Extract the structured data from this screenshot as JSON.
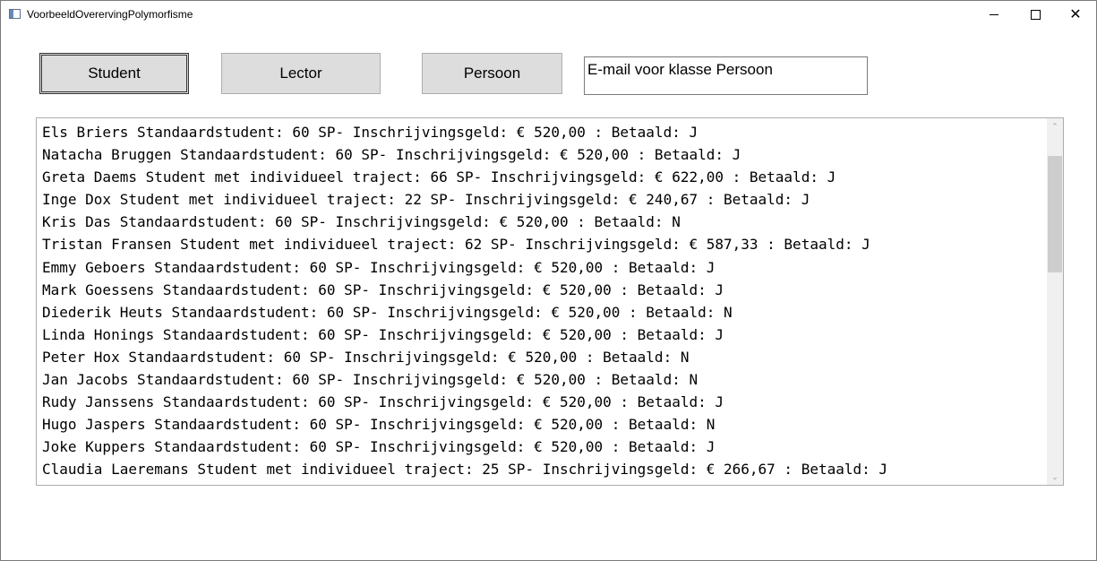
{
  "window": {
    "title": "VoorbeeldOverervingPolymorfisme",
    "minimize_icon": "minimize-icon",
    "maximize_icon": "maximize-icon",
    "close_glyph": "✕"
  },
  "buttons": {
    "student_label": "Student",
    "lector_label": "Lector",
    "persoon_label": "Persoon"
  },
  "email_field": {
    "value": "E-mail voor klasse Persoon"
  },
  "listbox": {
    "items": [
      "Els Briers Standaardstudent: 60 SP- Inschrijvingsgeld: € 520,00 : Betaald: J",
      "Natacha Bruggen Standaardstudent: 60 SP- Inschrijvingsgeld: € 520,00 : Betaald: J",
      "Greta Daems Student met individueel traject: 66 SP- Inschrijvingsgeld: € 622,00 : Betaald: J",
      "Inge Dox Student met individueel traject: 22 SP- Inschrijvingsgeld: € 240,67 : Betaald: J",
      "Kris Das Standaardstudent: 60 SP- Inschrijvingsgeld: € 520,00 : Betaald: N",
      "Tristan Fransen Student met individueel traject: 62 SP- Inschrijvingsgeld: € 587,33 : Betaald: J",
      "Emmy Geboers Standaardstudent: 60 SP- Inschrijvingsgeld: € 520,00 : Betaald: J",
      "Mark Goessens Standaardstudent: 60 SP- Inschrijvingsgeld: € 520,00 : Betaald: J",
      "Diederik Heuts Standaardstudent: 60 SP- Inschrijvingsgeld: € 520,00 : Betaald: N",
      "Linda Honings Standaardstudent: 60 SP- Inschrijvingsgeld: € 520,00 : Betaald: J",
      "Peter Hox Standaardstudent: 60 SP- Inschrijvingsgeld: € 520,00 : Betaald: N",
      "Jan Jacobs Standaardstudent: 60 SP- Inschrijvingsgeld: € 520,00 : Betaald: N",
      "Rudy Janssens Standaardstudent: 60 SP- Inschrijvingsgeld: € 520,00 : Betaald: J",
      "Hugo Jaspers Standaardstudent: 60 SP- Inschrijvingsgeld: € 520,00 : Betaald: N",
      "Joke Kuppers Standaardstudent: 60 SP- Inschrijvingsgeld: € 520,00 : Betaald: J",
      "Claudia Laeremans Student met individueel traject: 25 SP- Inschrijvingsgeld: € 266,67 : Betaald: J"
    ],
    "scroll_up_glyph": "⌃",
    "scroll_down_glyph": "⌄"
  }
}
